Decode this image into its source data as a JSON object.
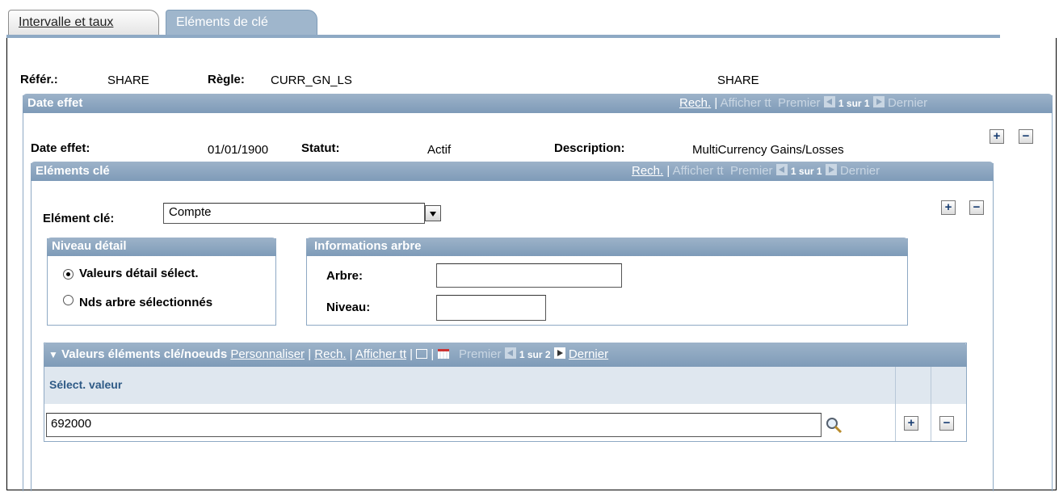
{
  "tabs": [
    {
      "label": "Intervalle et taux"
    },
    {
      "label": "Eléments de clé"
    }
  ],
  "header": {
    "ref_label": "Référ.:",
    "ref_value": "SHARE",
    "rule_label": "Règle:",
    "rule_value": "CURR_GN_LS",
    "rule_desc": "SHARE"
  },
  "date_effet_bar": {
    "title": "Date effet",
    "search": "Rech.",
    "sep": "|",
    "show_all": "Afficher tt",
    "first": "Premier",
    "count": "1 sur 1",
    "last": "Dernier"
  },
  "date_row": {
    "date_label": "Date effet:",
    "date_value": "01/01/1900",
    "status_label": "Statut:",
    "status_value": "Actif",
    "desc_label": "Description:",
    "desc_value": "MultiCurrency Gains/Losses"
  },
  "elements_bar": {
    "title": "Eléments clé",
    "search": "Rech.",
    "sep": "|",
    "show_all": "Afficher tt",
    "first": "Premier",
    "count": "1 sur 1",
    "last": "Dernier"
  },
  "element": {
    "label": "Elément clé:",
    "selected": "Compte"
  },
  "niveau": {
    "title": "Niveau détail",
    "option1": "Valeurs détail sélect.",
    "option2": "Nds arbre sélectionnés"
  },
  "arbre": {
    "title": "Informations arbre",
    "tree_label": "Arbre:",
    "tree_value": "",
    "level_label": "Niveau:",
    "level_value": ""
  },
  "valeurs_bar": {
    "title": "Valeurs éléments clé/noeuds",
    "customize": "Personnaliser",
    "sep": "|",
    "search": "Rech.",
    "show_all": "Afficher tt",
    "first": "Premier",
    "count": "1 sur 2",
    "last": "Dernier"
  },
  "grid": {
    "column": "Sélect. valeur",
    "rows": [
      {
        "value": "692000"
      }
    ]
  },
  "buttons": {
    "plus": "+",
    "minus": "−"
  }
}
